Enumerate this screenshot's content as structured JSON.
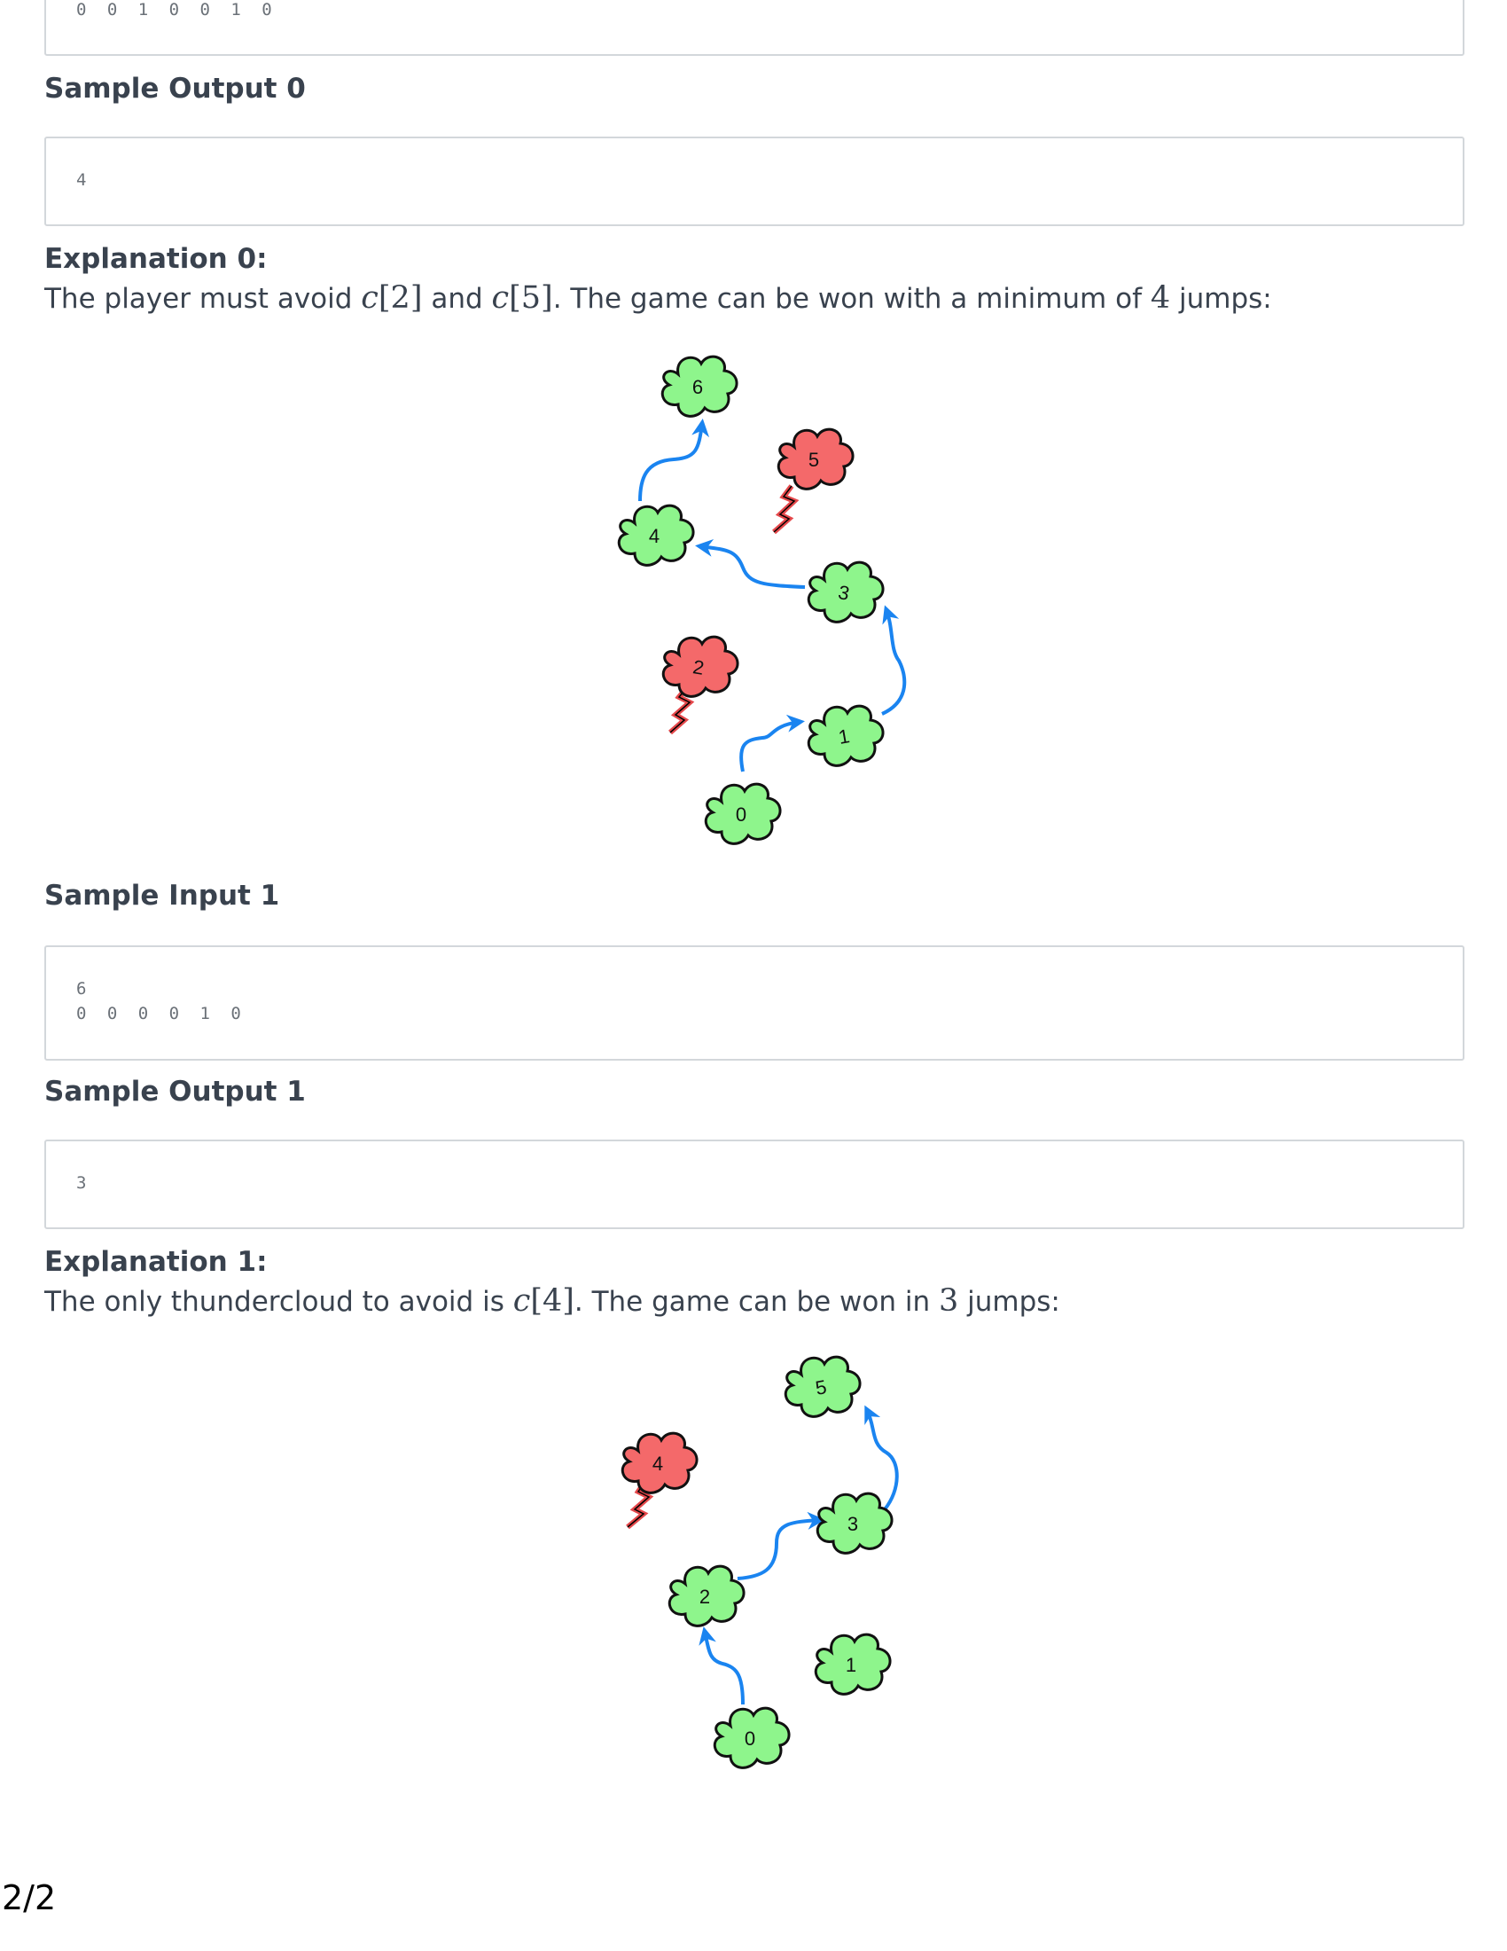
{
  "input0": {
    "line": "0 0 1 0 0 1 0"
  },
  "output0": {
    "heading": "Sample Output 0",
    "value": "4"
  },
  "explanation0": {
    "heading": "Explanation 0:",
    "t1": "The player must avoid ",
    "m1_var": "c",
    "m1_idx": "[2]",
    "t2": " and ",
    "m2_var": "c",
    "m2_idx": "[5]",
    "t3": ". The game can be won with a minimum of ",
    "m3": "4",
    "t4": " jumps:"
  },
  "figure0": {
    "clouds": [
      {
        "label": "0",
        "status": "safe"
      },
      {
        "label": "1",
        "status": "safe"
      },
      {
        "label": "2",
        "status": "thunder"
      },
      {
        "label": "3",
        "status": "safe"
      },
      {
        "label": "4",
        "status": "safe"
      },
      {
        "label": "5",
        "status": "thunder"
      },
      {
        "label": "6",
        "status": "safe"
      }
    ],
    "jump_path": [
      "0",
      "1",
      "3",
      "4",
      "6"
    ]
  },
  "input1": {
    "heading": "Sample Input 1",
    "line1": "6",
    "line2": "0 0 0 0 1 0"
  },
  "output1": {
    "heading": "Sample Output 1",
    "value": "3"
  },
  "explanation1": {
    "heading": "Explanation 1:",
    "t1": "The only thundercloud to avoid is ",
    "m1_var": "c",
    "m1_idx": "[4]",
    "t2": ". The game can be won in ",
    "m2": "3",
    "t3": " jumps:"
  },
  "figure1": {
    "clouds": [
      {
        "label": "0",
        "status": "safe"
      },
      {
        "label": "1",
        "status": "safe"
      },
      {
        "label": "2",
        "status": "safe"
      },
      {
        "label": "3",
        "status": "safe"
      },
      {
        "label": "4",
        "status": "thunder"
      },
      {
        "label": "5",
        "status": "safe"
      }
    ],
    "jump_path": [
      "0",
      "2",
      "3",
      "5"
    ]
  },
  "footer": {
    "page": "2/2"
  },
  "colors": {
    "safe_cloud": "#8ef58c",
    "thunder_cloud": "#f4696a",
    "arrow": "#1a84f0",
    "text": "#39424e"
  }
}
